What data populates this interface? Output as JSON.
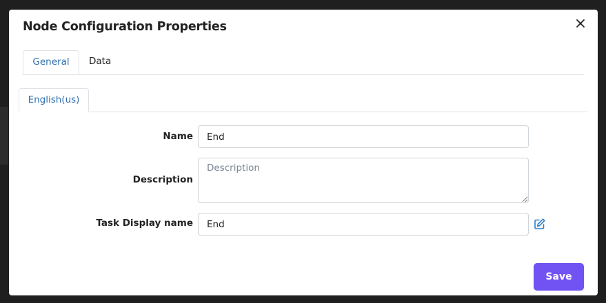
{
  "modal": {
    "title": "Node Configuration Properties"
  },
  "tabs": [
    {
      "label": "General",
      "active": true
    },
    {
      "label": "Data",
      "active": false
    }
  ],
  "language_tabs": [
    {
      "label": "English(us)",
      "active": true
    }
  ],
  "form": {
    "name": {
      "label": "Name",
      "value": "End"
    },
    "description": {
      "label": "Description",
      "value": "",
      "placeholder": "Description"
    },
    "task_display_name": {
      "label": "Task Display name",
      "value": "End"
    }
  },
  "actions": {
    "save_label": "Save"
  },
  "icons": {
    "close": "close-icon",
    "edit": "edit-icon"
  },
  "colors": {
    "accent": "#7152f3",
    "tab_active_text": "#2f6fad",
    "edit_icon": "#2f7fc5"
  }
}
